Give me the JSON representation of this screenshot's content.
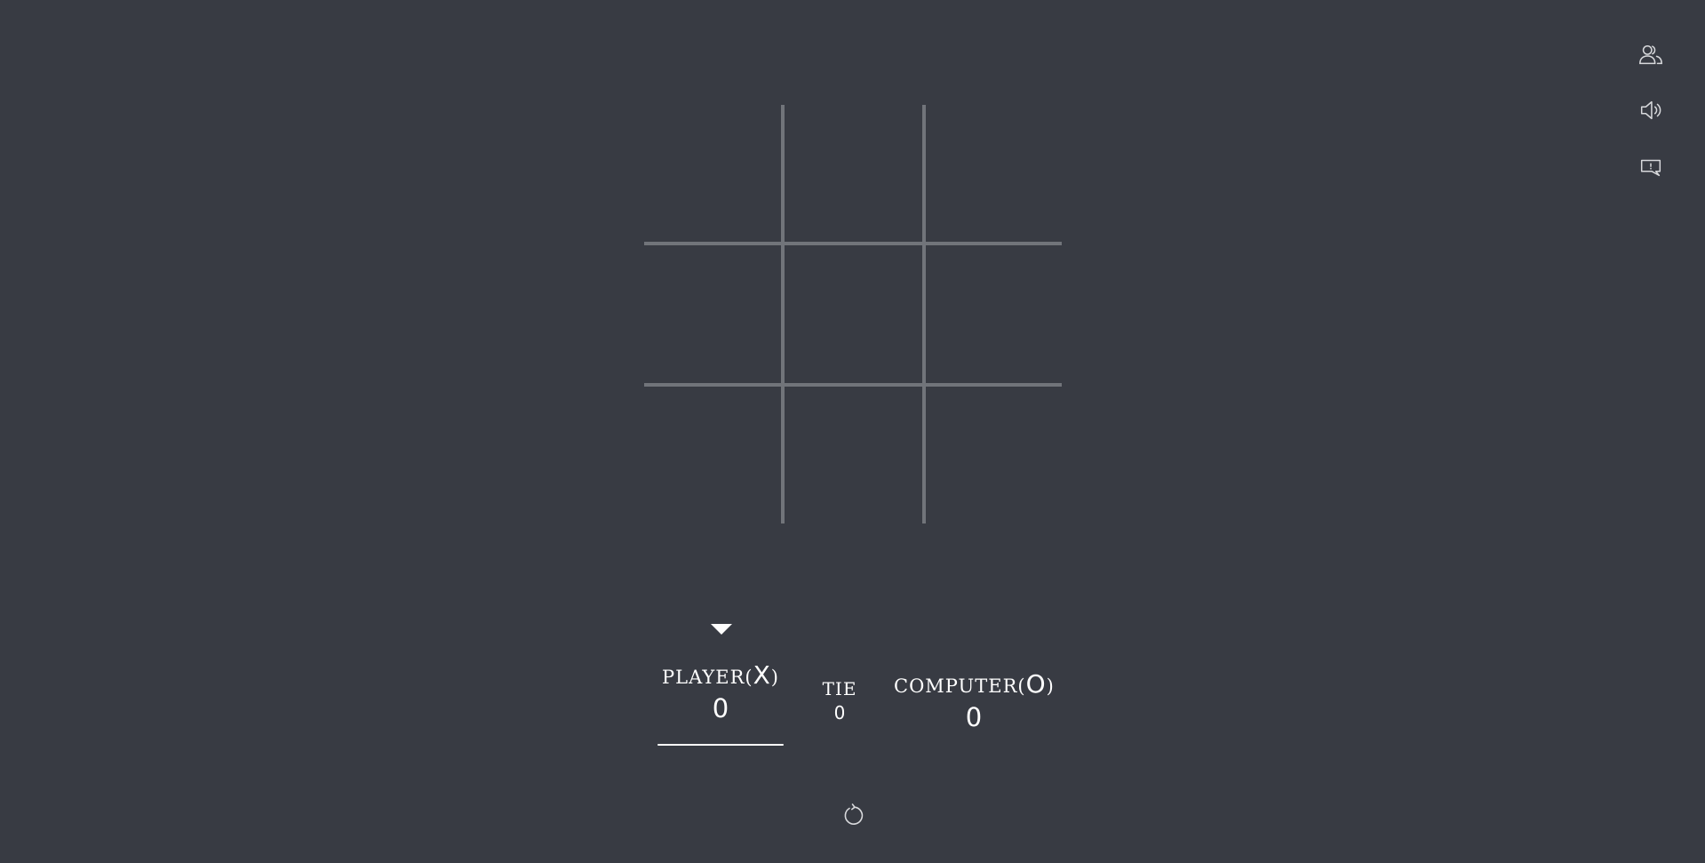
{
  "game": {
    "board": [
      "",
      "",
      "",
      "",
      "",
      "",
      "",
      "",
      ""
    ],
    "current_turn": "X"
  },
  "score": {
    "player_label": "PLAYER",
    "player_mark": "X",
    "player_value": "0",
    "tie_label": "TIE",
    "tie_value": "0",
    "computer_label": "COMPUTER",
    "computer_mark": "O",
    "computer_value": "0"
  },
  "tools": {
    "icons": [
      "two-players-icon",
      "sound-icon",
      "feedback-icon"
    ]
  },
  "controls": {
    "restart_icon": "restart-icon"
  },
  "colors": {
    "background": "#383b43",
    "grid": "#71747a",
    "text": "#ffffff"
  }
}
